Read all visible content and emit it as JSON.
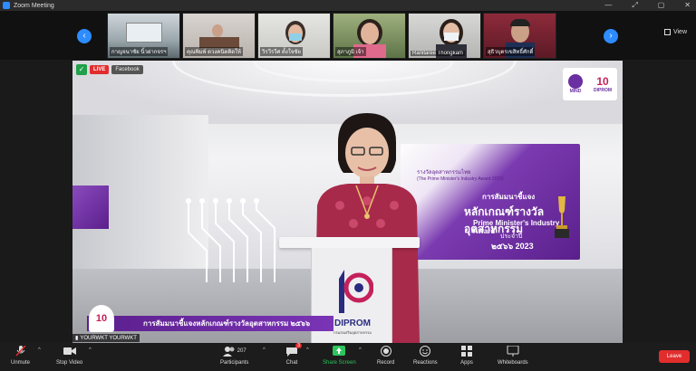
{
  "window": {
    "title": "Zoom Meeting",
    "controls": [
      "—",
      "⤢",
      "▢",
      "✕"
    ]
  },
  "strip": {
    "view_label": "View",
    "participants": [
      {
        "label": "กาญจนาชัย นิ้วฝากจรฯ"
      },
      {
        "label": "คุณพิมพ์ ดวงคนิตติดให้"
      },
      {
        "label": "วิรวีรวีศ ตั้งใจชัย"
      },
      {
        "label": "สุภาภูมิ เจ้า"
      },
      {
        "label": "Ranitaree Thongkam"
      },
      {
        "label": "สุธิวบุตรเขสิทธิ์ศักดิ์"
      }
    ]
  },
  "stage": {
    "live_label": "LIVE",
    "facebook_label": "Facebook",
    "logos": {
      "mind": "MIND",
      "dip_number": "10",
      "dip": "DIPROM"
    },
    "banner": {
      "line1": "รางวัลอุตสาหกรรมไทย",
      "line2": "(The Prime Minister's Industry Award 2023)",
      "line3": "การสัมมนาชี้แจง",
      "line4": "หลักเกณฑ์รางวัลอุตสาหกรรม",
      "line5": "Prime Minister's Industry Award",
      "line6": "ประจำปี",
      "line7": "๒๕๖๖ 2023"
    },
    "podium": {
      "name": "DIPROM",
      "sub": "กรมส่งเสริมอุตสาหกรรม"
    },
    "lower_third": "การสัมมนาชี้แจงหลักเกณฑ์รางวัลอุตสาหกรรม ๒๕๖๖",
    "lower_logo": "10",
    "speaker_name": "YOURWKT YOURWKT"
  },
  "toolbar": {
    "unmute": "Unmute",
    "stop_video": "Stop Video",
    "participants_count": "207",
    "participants": "Participants",
    "chat": "Chat",
    "chat_badge": "3",
    "share_screen": "Share Screen",
    "record": "Record",
    "reactions": "Reactions",
    "apps": "Apps",
    "whiteboards": "Whiteboards",
    "leave": "Leave"
  },
  "colors": {
    "accent": "#2d8cff",
    "live": "#e22d2d",
    "share": "#2ec45c",
    "brand_purple": "#5b1f8c"
  }
}
